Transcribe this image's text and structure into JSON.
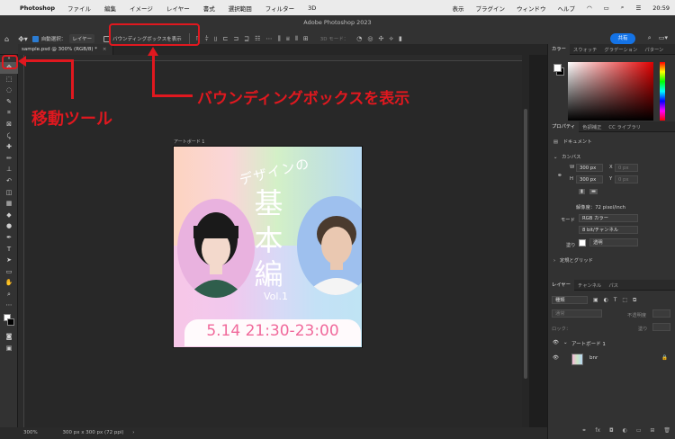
{
  "menubar": {
    "apple": "",
    "app": "Photoshop",
    "items": [
      "ファイル",
      "編集",
      "イメージ",
      "レイヤー",
      "書式",
      "選択範囲",
      "フィルター",
      "3D"
    ],
    "right_items": [
      "表示",
      "プラグイン",
      "ウィンドウ",
      "ヘルプ"
    ],
    "time": "20:59"
  },
  "window": {
    "title": "Adobe Photoshop 2023"
  },
  "options": {
    "auto_select_label": "自動選択：",
    "auto_select_value": "レイヤー",
    "bbox_label": "バウンディングボックスを表示",
    "mode3d_label": "3D モード：",
    "share_label": "共有"
  },
  "document": {
    "tab_label": "sample.psd @ 300% (RGB/8) *",
    "artboard_label": "アートボード 1",
    "zoom": "300%",
    "doc_info": "300 px x 300 px (72 ppi)"
  },
  "artwork": {
    "subtitle": "デザインの",
    "title_chars": [
      "基",
      "本",
      "編"
    ],
    "vol": "Vol.1",
    "date": "5.14  21:30-23:00"
  },
  "annotations": {
    "move_tool": "移動ツール",
    "bbox": "バウンディングボックスを表示",
    "color": "#e0181f"
  },
  "color_panel": {
    "tabs": [
      "カラー",
      "スウォッチ",
      "グラデーション",
      "パターン"
    ]
  },
  "properties_panel": {
    "tabs": [
      "プロパティ",
      "色調補正",
      "CC ライブラリ"
    ],
    "doc_label": "ドキュメント",
    "canvas_label": "カンバス",
    "w_label": "W",
    "w_value": "300 px",
    "h_label": "H",
    "h_value": "300 px",
    "x_label": "X",
    "x_value": "0 px",
    "y_label": "Y",
    "y_value": "0 px",
    "resolution": "解像度：72 pixel/inch",
    "mode_label": "モード",
    "mode_value": "RGB カラー",
    "depth_value": "8 bit/チャンネル",
    "fill_label": "塗り",
    "fill_value": "透明",
    "rulers_label": "定規とグリッド"
  },
  "layers_panel": {
    "tabs": [
      "レイヤー",
      "チャンネル",
      "パス"
    ],
    "kind_label": "種類",
    "blend_mode": "通常",
    "opacity_label": "不透明度",
    "lock_label": "ロック：",
    "fill_label": "塗り",
    "layers": [
      {
        "name": "アートボード 1"
      },
      {
        "name": "bnr"
      }
    ]
  }
}
